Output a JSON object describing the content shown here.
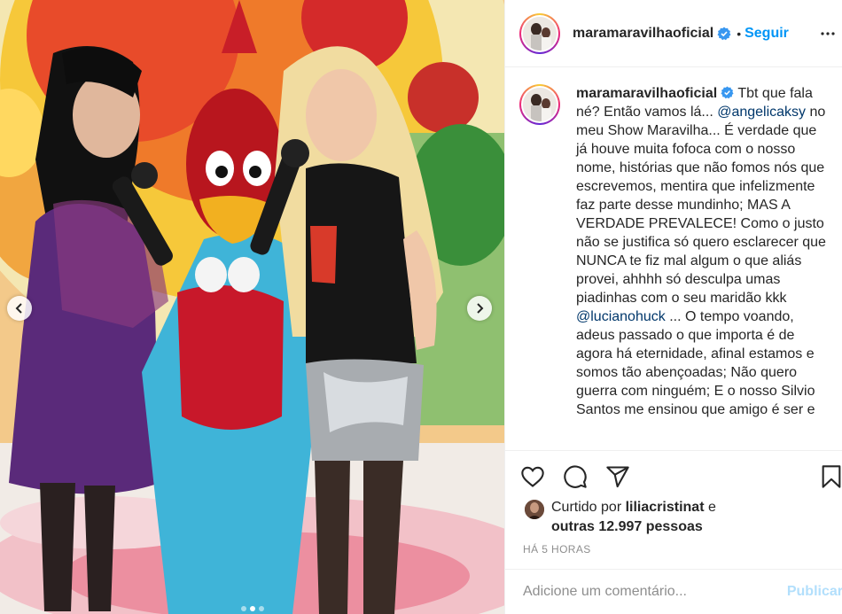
{
  "post": {
    "author": "maramaravilhaoficial",
    "verified": true,
    "separator": "•",
    "follow_label": "Seguir",
    "caption": {
      "username": "maramaravilhaoficial",
      "part1": " Tbt que fala né? Então vamos lá... ",
      "mention1": "@angelicaksy",
      "part2": " no meu Show Maravilha... É verdade que já houve muita fofoca com o nosso nome, histórias que não fomos nós que escrevemos, mentira que infelizmente faz parte desse mundinho; MAS A VERDADE PREVALECE! Como o justo não se justifica só quero esclarecer que NUNCA te fiz mal algum o que aliás provei, ahhhh só desculpa umas piadinhas com o seu maridão kkk ",
      "mention2": "@lucianohuck",
      "part3": " ... O tempo voando, adeus passado o que importa é de agora há eternidade, afinal estamos e somos tão abençoadas; Não quero guerra com ninguém; E o nosso Silvio Santos me ensinou que amigo é ser e"
    },
    "likes": {
      "prefix": "Curtido por ",
      "user": "liliacristinat",
      "middle": " e ",
      "others": "outras 12.997 pessoas"
    },
    "timestamp": "HÁ 5 HORAS",
    "comment": {
      "placeholder": "Adicione um comentário...",
      "publish_label": "Publicar"
    }
  },
  "carousel": {
    "slide_count": 3,
    "active_index": 1
  },
  "icons": {
    "header": [
      "verified-badge-icon",
      "more-options-icon"
    ],
    "actions": [
      "heart-icon",
      "comment-icon",
      "share-icon",
      "bookmark-icon"
    ],
    "photo": [
      "chevron-left-icon",
      "chevron-right-icon"
    ]
  },
  "colors": {
    "link": "#0095f6",
    "mention": "#00376b",
    "publish_disabled": "#b2dffc",
    "muted": "#8e8e8e"
  }
}
